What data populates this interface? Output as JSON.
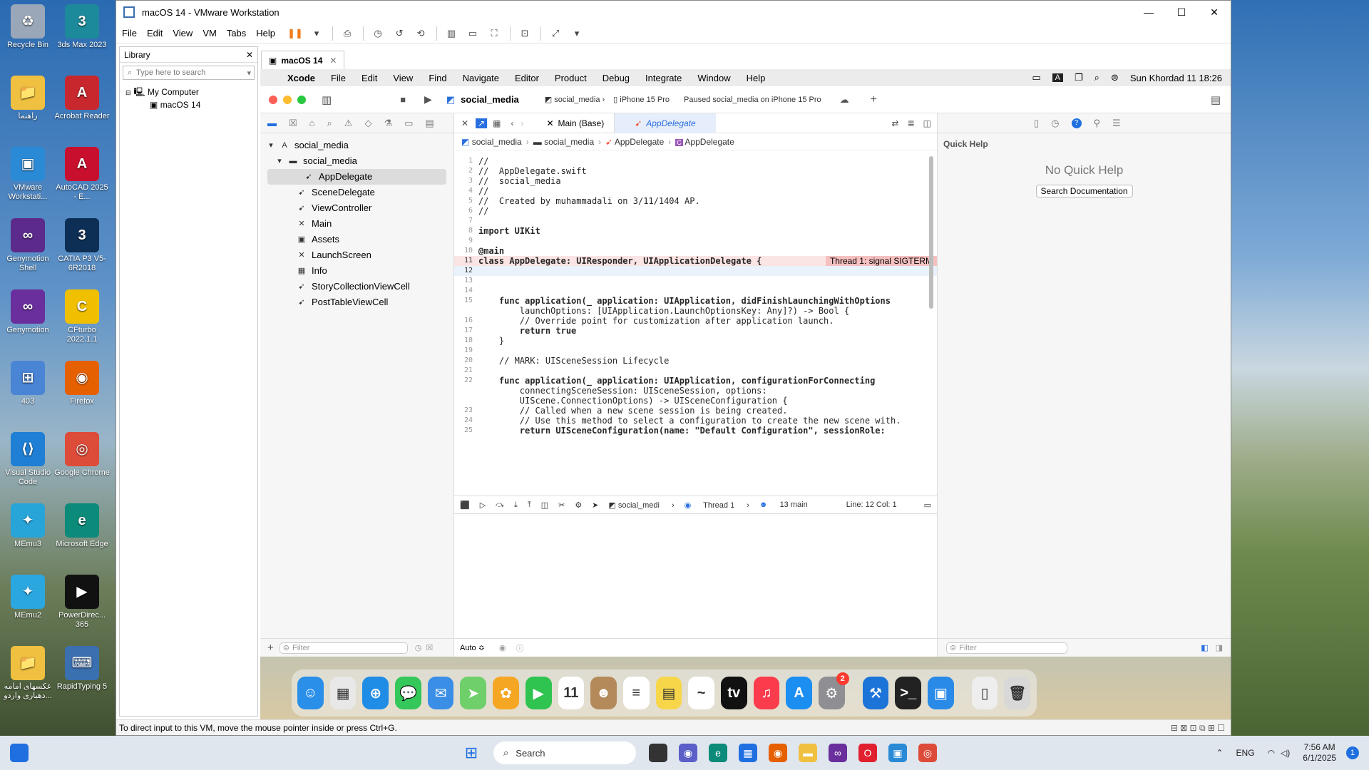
{
  "desktop": {
    "icons": [
      {
        "label": "Recycle Bin",
        "color": "#9aa7b8",
        "glyph": "♻"
      },
      {
        "label": "3ds Max 2023",
        "color": "#1c8a9a",
        "glyph": "3"
      },
      {
        "label": "راهنما",
        "color": "#f0c040",
        "glyph": "📁"
      },
      {
        "label": "Acrobat Reader",
        "color": "#c8282d",
        "glyph": "A"
      },
      {
        "label": "VMware Workstati...",
        "color": "#2a8ad6",
        "glyph": "▣"
      },
      {
        "label": "AutoCAD 2025 - E...",
        "color": "#c8102e",
        "glyph": "A"
      },
      {
        "label": "Genymotion Shell",
        "color": "#5c2a8a",
        "glyph": "∞"
      },
      {
        "label": "CATIA P3 V5-6R2018",
        "color": "#0d2f55",
        "glyph": "3"
      },
      {
        "label": "Genymotion",
        "color": "#6a2f9c",
        "glyph": "∞"
      },
      {
        "label": "CFturbo 2022.1.1",
        "color": "#f0c000",
        "glyph": "C"
      },
      {
        "label": "403",
        "color": "#4a84d4",
        "glyph": "⊞"
      },
      {
        "label": "Firefox",
        "color": "#e66000",
        "glyph": "◉"
      },
      {
        "label": "Visual Studio Code",
        "color": "#1f7fd4",
        "glyph": "⟨⟩"
      },
      {
        "label": "Google Chrome",
        "color": "#dd4b39",
        "glyph": "◎"
      },
      {
        "label": "MEmu3",
        "color": "#27a4d8",
        "glyph": "✦"
      },
      {
        "label": "Microsoft Edge",
        "color": "#0c8a7a",
        "glyph": "e"
      },
      {
        "label": "MEmu2",
        "color": "#2ba7e0",
        "glyph": "✦"
      },
      {
        "label": "PowerDirec... 365",
        "color": "#111",
        "glyph": "▶"
      },
      {
        "label": "عکسهای امامه دهیاری واردو...",
        "color": "#f0c040",
        "glyph": "📁"
      },
      {
        "label": "RapidTyping 5",
        "color": "#3a6fb0",
        "glyph": "⌨"
      }
    ]
  },
  "vmware": {
    "title": "macOS 14 - VMware Workstation",
    "menu": [
      "File",
      "Edit",
      "View",
      "VM",
      "Tabs",
      "Help"
    ],
    "library": {
      "title": "Library",
      "search_placeholder": "Type here to search",
      "tree": [
        "My Computer",
        "macOS 14"
      ]
    },
    "tab_label": "macOS 14",
    "status_text": "To direct input to this VM, move the mouse pointer inside or press Ctrl+G."
  },
  "mac": {
    "menubar": [
      "Xcode",
      "File",
      "Edit",
      "View",
      "Find",
      "Navigate",
      "Editor",
      "Product",
      "Debug",
      "Integrate",
      "Window",
      "Help"
    ],
    "clock": "Sun Khordad 11  18:26"
  },
  "xcode": {
    "project": "social_media",
    "scheme": "social_media",
    "device": "iPhone 15 Pro",
    "status": "Paused social_media on iPhone 15 Pro",
    "tabs": [
      "Main (Base)",
      "AppDelegate"
    ],
    "jump_bar": [
      "social_media",
      "social_media",
      "AppDelegate",
      "AppDelegate"
    ],
    "files": [
      {
        "name": "social_media",
        "icon": "A",
        "indent": 0
      },
      {
        "name": "social_media",
        "icon": "▬",
        "indent": 1
      },
      {
        "name": "AppDelegate",
        "icon": "➹",
        "indent": 2,
        "selected": true
      },
      {
        "name": "SceneDelegate",
        "icon": "➹",
        "indent": 2
      },
      {
        "name": "ViewController",
        "icon": "➹",
        "indent": 2
      },
      {
        "name": "Main",
        "icon": "✕",
        "indent": 2
      },
      {
        "name": "Assets",
        "icon": "▣",
        "indent": 2
      },
      {
        "name": "LaunchScreen",
        "icon": "✕",
        "indent": 2
      },
      {
        "name": "Info",
        "icon": "▦",
        "indent": 2
      },
      {
        "name": "StoryCollectionViewCell",
        "icon": "➹",
        "indent": 2
      },
      {
        "name": "PostTableViewCell",
        "icon": "➹",
        "indent": 2
      }
    ],
    "code_lines": [
      {
        "n": "1",
        "t": "//"
      },
      {
        "n": "2",
        "t": "//  AppDelegate.swift"
      },
      {
        "n": "3",
        "t": "//  social_media"
      },
      {
        "n": "4",
        "t": "//"
      },
      {
        "n": "5",
        "t": "//  Created by muhammadali on 3/11/1404 AP."
      },
      {
        "n": "6",
        "t": "//"
      },
      {
        "n": "7",
        "t": ""
      },
      {
        "n": "8",
        "t": "import UIKit"
      },
      {
        "n": "9",
        "t": ""
      },
      {
        "n": "10",
        "t": "@main"
      },
      {
        "n": "11",
        "t": "class AppDelegate: UIResponder, UIApplicationDelegate {"
      },
      {
        "n": "12",
        "t": ""
      },
      {
        "n": "13",
        "t": ""
      },
      {
        "n": "14",
        "t": ""
      },
      {
        "n": "15",
        "t": "    func application(_ application: UIApplication, didFinishLaunchingWithOptions"
      },
      {
        "n": "",
        "t": "        launchOptions: [UIApplication.LaunchOptionsKey: Any]?) -> Bool {"
      },
      {
        "n": "16",
        "t": "        // Override point for customization after application launch."
      },
      {
        "n": "17",
        "t": "        return true"
      },
      {
        "n": "18",
        "t": "    }"
      },
      {
        "n": "19",
        "t": ""
      },
      {
        "n": "20",
        "t": "    // MARK: UISceneSession Lifecycle"
      },
      {
        "n": "21",
        "t": ""
      },
      {
        "n": "22",
        "t": "    func application(_ application: UIApplication, configurationForConnecting"
      },
      {
        "n": "",
        "t": "        connectingSceneSession: UISceneSession, options:"
      },
      {
        "n": "",
        "t": "        UIScene.ConnectionOptions) -> UISceneConfiguration {"
      },
      {
        "n": "23",
        "t": "        // Called when a new scene session is being created."
      },
      {
        "n": "24",
        "t": "        // Use this method to select a configuration to create the new scene with."
      },
      {
        "n": "25",
        "t": "        return UISceneConfiguration(name: \"Default Configuration\", sessionRole:"
      }
    ],
    "error_badge": "Thread 1: signal SIGTERM",
    "debug": {
      "target": "social_medi",
      "thread": "Thread 1",
      "frame": "13 main",
      "position": "Line: 12  Col: 1"
    },
    "bottom_mode": "Auto ≎",
    "filter_placeholder": "Filter",
    "quick_help": {
      "title": "Quick Help",
      "empty": "No Quick Help",
      "button": "Search Documentation"
    }
  },
  "dock": [
    {
      "name": "Finder",
      "color": "#2a8fe8",
      "glyph": "☺"
    },
    {
      "name": "Launchpad",
      "color": "#e8e8e8",
      "glyph": "▦"
    },
    {
      "name": "Safari",
      "color": "#1f8ce6",
      "glyph": "⊕"
    },
    {
      "name": "Messages",
      "color": "#34c759",
      "glyph": "💬"
    },
    {
      "name": "Mail",
      "color": "#3a8ee6",
      "glyph": "✉"
    },
    {
      "name": "Maps",
      "color": "#6fcf6a",
      "glyph": "➤"
    },
    {
      "name": "Photos",
      "color": "#f5a623",
      "glyph": "✿"
    },
    {
      "name": "FaceTime",
      "color": "#2fc350",
      "glyph": "▶"
    },
    {
      "name": "Calendar",
      "color": "#ffffff",
      "glyph": "11"
    },
    {
      "name": "Contacts",
      "color": "#b48a5a",
      "glyph": "☻"
    },
    {
      "name": "Reminders",
      "color": "#ffffff",
      "glyph": "≡"
    },
    {
      "name": "Notes",
      "color": "#f7d64a",
      "glyph": "▤"
    },
    {
      "name": "Freeform",
      "color": "#ffffff",
      "glyph": "~"
    },
    {
      "name": "TV",
      "color": "#111111",
      "glyph": "tv"
    },
    {
      "name": "Music",
      "color": "#fa3c4c",
      "glyph": "♫"
    },
    {
      "name": "App Store",
      "color": "#1b8ef2",
      "glyph": "A"
    },
    {
      "name": "System Settings",
      "color": "#8e8e93",
      "glyph": "⚙"
    },
    {
      "name": "Xcode",
      "color": "#1c74d9",
      "glyph": "⚒"
    },
    {
      "name": "Terminal",
      "color": "#222222",
      "glyph": ">_"
    },
    {
      "name": "Xcode Simulator",
      "color": "#2a8ae8",
      "glyph": "▣"
    },
    {
      "name": "Downloads",
      "color": "#eeeeee",
      "glyph": "▯"
    },
    {
      "name": "Trash",
      "color": "#d8d8d8",
      "glyph": "🗑"
    }
  ],
  "settings_badge": "2",
  "taskbar": {
    "search_label": "Search",
    "lang": "ENG",
    "time": "7:56 AM",
    "date": "6/1/2025",
    "notif": "1"
  }
}
